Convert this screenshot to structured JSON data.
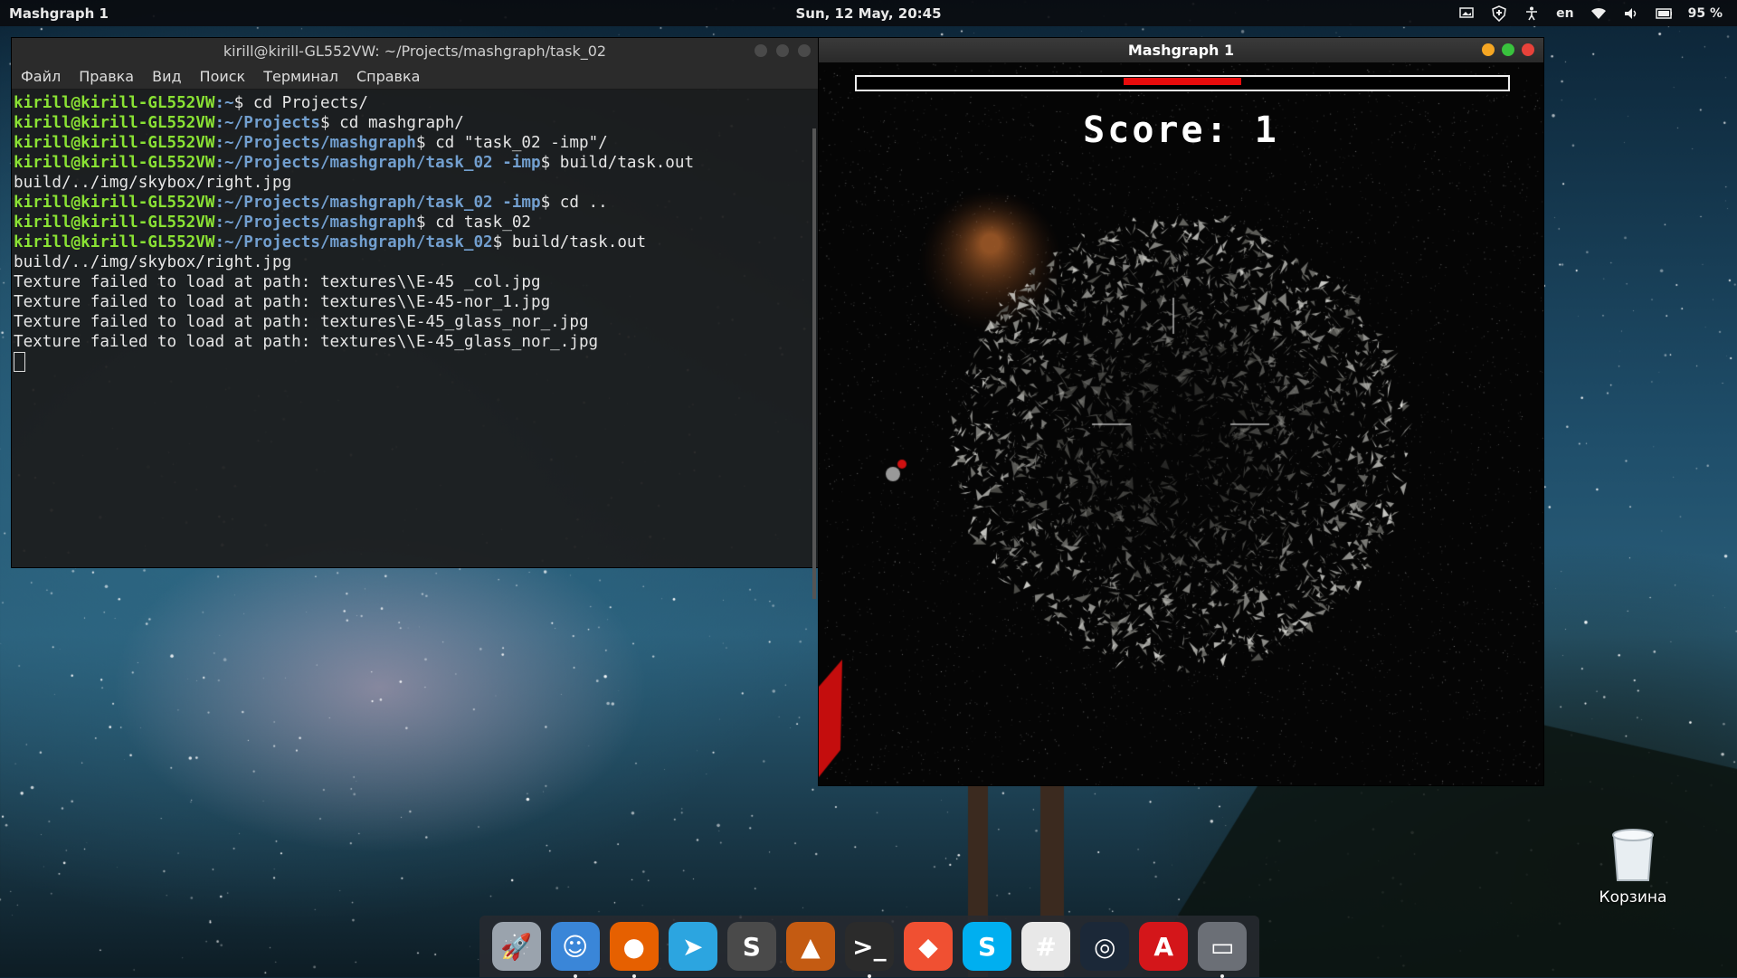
{
  "topbar": {
    "app_name": "Mashgraph 1",
    "datetime": "Sun, 12 May, 20:45",
    "keyboard_layout": "en",
    "battery": "95 %",
    "indicators": [
      "screen-icon",
      "shield-icon",
      "accessibility-icon",
      "wifi-icon",
      "volume-icon",
      "battery-icon"
    ]
  },
  "terminal": {
    "title": "kirill@kirill-GL552VW: ~/Projects/mashgraph/task_02",
    "menu": [
      "Файл",
      "Правка",
      "Вид",
      "Поиск",
      "Терминал",
      "Справка"
    ],
    "lines": [
      {
        "user": "kirill@kirill-GL552VW",
        "path": ":~",
        "cmd": "$ cd Projects/"
      },
      {
        "user": "kirill@kirill-GL552VW",
        "path": ":~/Projects",
        "cmd": "$ cd mashgraph/"
      },
      {
        "user": "kirill@kirill-GL552VW",
        "path": ":~/Projects/mashgraph",
        "cmd": "$ cd \"task_02 -imp\"/"
      },
      {
        "user": "kirill@kirill-GL552VW",
        "path": ":~/Projects/mashgraph/task_02 -imp",
        "cmd": "$ build/task.out"
      },
      {
        "text": "build/../img/skybox/right.jpg"
      },
      {
        "user": "kirill@kirill-GL552VW",
        "path": ":~/Projects/mashgraph/task_02 -imp",
        "cmd": "$ cd .."
      },
      {
        "user": "kirill@kirill-GL552VW",
        "path": ":~/Projects/mashgraph",
        "cmd": "$ cd task_02"
      },
      {
        "user": "kirill@kirill-GL552VW",
        "path": ":~/Projects/mashgraph/task_02",
        "cmd": "$ build/task.out"
      },
      {
        "text": "build/../img/skybox/right.jpg"
      },
      {
        "text": "Texture failed to load at path: textures\\\\E-45 _col.jpg"
      },
      {
        "text": "Texture failed to load at path: textures\\\\E-45-nor_1.jpg"
      },
      {
        "text": "Texture failed to load at path: textures\\E-45_glass_nor_.jpg"
      },
      {
        "text": "Texture failed to load at path: textures\\\\E-45_glass_nor_.jpg"
      }
    ]
  },
  "game": {
    "title": "Mashgraph 1",
    "score_text": "Score: 1",
    "health_fill_start": 0.41,
    "health_fill_end": 0.59,
    "health_color": "#e80c0c"
  },
  "desktop": {
    "trash_label": "Корзина"
  },
  "dock": {
    "items": [
      {
        "name": "launchpad-icon",
        "glyph": "🚀",
        "bg": "#9aa3ad",
        "running": false
      },
      {
        "name": "finder-icon",
        "glyph": "☺",
        "bg": "#3a86d8",
        "running": true
      },
      {
        "name": "firefox-icon",
        "glyph": "●",
        "bg": "#e66000",
        "running": true
      },
      {
        "name": "telegram-icon",
        "glyph": "➤",
        "bg": "#2ca5e0",
        "running": false
      },
      {
        "name": "sublime-text-icon",
        "glyph": "S",
        "bg": "#4a4a4a",
        "running": false
      },
      {
        "name": "matlab-icon",
        "glyph": "▲",
        "bg": "#c45b12",
        "running": false
      },
      {
        "name": "terminal-icon",
        "glyph": ">_",
        "bg": "#2b2b2b",
        "running": true
      },
      {
        "name": "git-icon",
        "glyph": "◆",
        "bg": "#f05032",
        "running": false
      },
      {
        "name": "skype-icon",
        "glyph": "S",
        "bg": "#00aff0",
        "running": false
      },
      {
        "name": "slack-icon",
        "glyph": "#",
        "bg": "#e8e8e8",
        "running": false
      },
      {
        "name": "steam-icon",
        "glyph": "◎",
        "bg": "#1b2838",
        "running": false
      },
      {
        "name": "pdf-reader-icon",
        "glyph": "A",
        "bg": "#d4161a",
        "running": false
      },
      {
        "name": "window-icon",
        "glyph": "▭",
        "bg": "#6b6f76",
        "running": true
      }
    ]
  }
}
